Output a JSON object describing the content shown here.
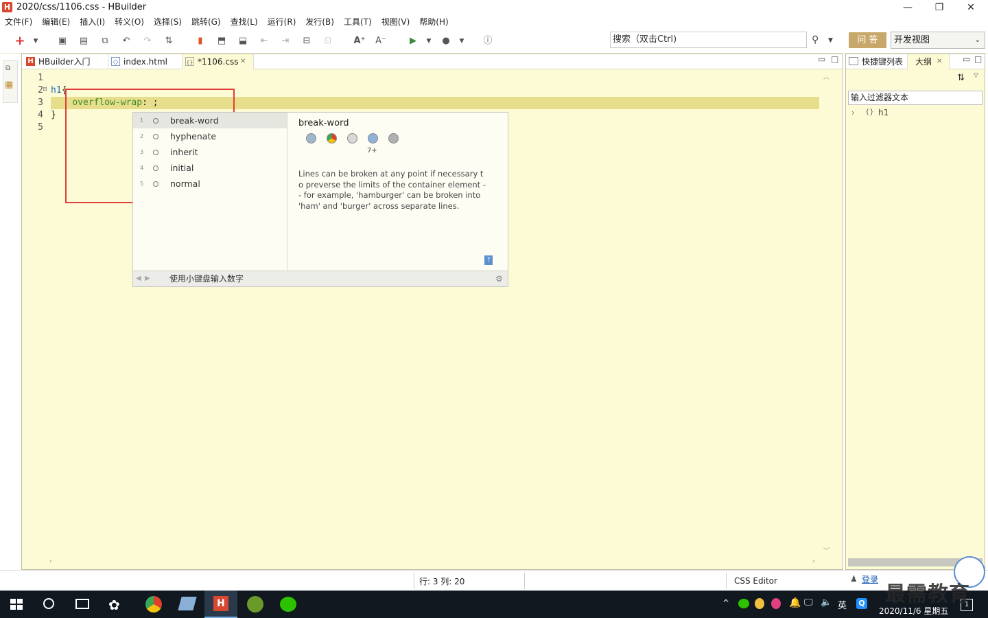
{
  "window": {
    "app_icon": "H",
    "title": "2020/css/1106.css  -  HBuilder",
    "min": "—",
    "restore": "❐",
    "close": "✕"
  },
  "menu": [
    "文件(F)",
    "编辑(E)",
    "插入(I)",
    "转义(O)",
    "选择(S)",
    "跳转(G)",
    "查找(L)",
    "运行(R)",
    "发行(B)",
    "工具(T)",
    "视图(V)",
    "帮助(H)"
  ],
  "toolbar": {
    "search_placeholder": "搜索（双击Ctrl)",
    "qa_label": "问 答",
    "view_select": "开发视图"
  },
  "tabs": [
    {
      "label": "HBuilder入门",
      "icon": "H"
    },
    {
      "label": "index.html",
      "icon": "◇"
    },
    {
      "label": "*1106.css",
      "icon": "{}",
      "close": "✕"
    }
  ],
  "editor": {
    "line_numbers": [
      "1",
      "2",
      "3",
      "4",
      "5"
    ],
    "code": {
      "l2_sel": "h1",
      "l2_brace": "{",
      "l3_prop": "overflow-wrap",
      "l3_rest": ": ;",
      "l4": "}"
    }
  },
  "autocomplete": {
    "items": [
      {
        "num": "1",
        "label": "break-word"
      },
      {
        "num": "2",
        "label": "hyphenate"
      },
      {
        "num": "3",
        "label": "inherit"
      },
      {
        "num": "4",
        "label": "initial"
      },
      {
        "num": "5",
        "label": "normal"
      }
    ],
    "detail_title": "break-word",
    "browser_version": "7+",
    "description": "Lines can be broken at any point if necessary to preverse the limits of the container element -- for example, 'hamburger' can be broken into 'ham' and 'burger' across separate lines.",
    "footer_hint": "使用小键盘输入数字"
  },
  "right_panel": {
    "tab_shortcuts": "快捷键列表",
    "tab_outline": "大纲",
    "filter_placeholder": "输入过滤器文本",
    "tree_item": "h1",
    "tree_icon": "{}"
  },
  "status": {
    "position": "行: 3 列: 20",
    "editor_type": "CSS Editor",
    "login": "登录"
  },
  "taskbar": {
    "ime": "英",
    "datetime": "2020/11/6 星期五",
    "watermark": "最需教育",
    "notify_count": "1"
  }
}
